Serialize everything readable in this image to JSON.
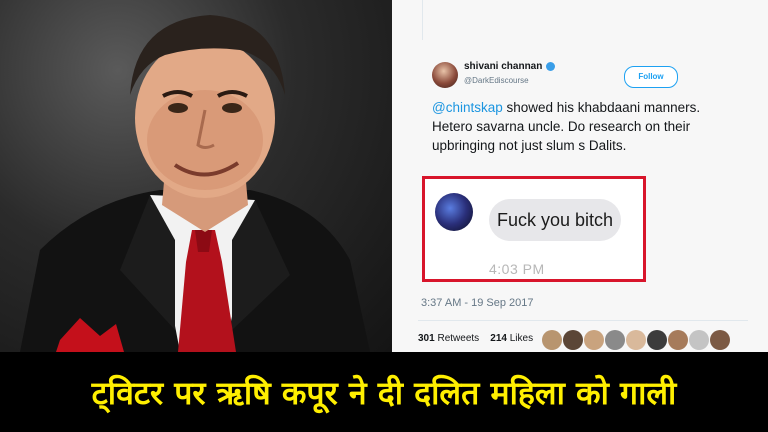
{
  "tweet": {
    "display_name": "shivani channan",
    "handle": "@DarkEdiscourse",
    "follow_label": "Follow",
    "mention": "@chintskap",
    "body_rest": " showed his khabdaani manners. Hetero savarna uncle. Do research on their upbringing not just slum s Dalits.",
    "screenshot": {
      "message": "Fuck you bitch",
      "time": "4:03 PM"
    },
    "timestamp": "3:37 AM - 19 Sep 2017",
    "retweets_count": "301",
    "retweets_label": "Retweets",
    "likes_count": "214",
    "likes_label": "Likes",
    "liker_avatar_colors": [
      "#b8956f",
      "#5b4636",
      "#c9a37e",
      "#8a8a8a",
      "#d9b99b",
      "#3c3c3c",
      "#a67b5b",
      "#c4c4c4",
      "#7c5a44"
    ]
  },
  "banner": {
    "headline": "ट्विटर पर ऋषि कपूर ने दी दलित महिला को गाली",
    "text_color": "#ffef00"
  },
  "colors": {
    "highlight_border": "#d8152b",
    "link": "#1b95e0"
  }
}
